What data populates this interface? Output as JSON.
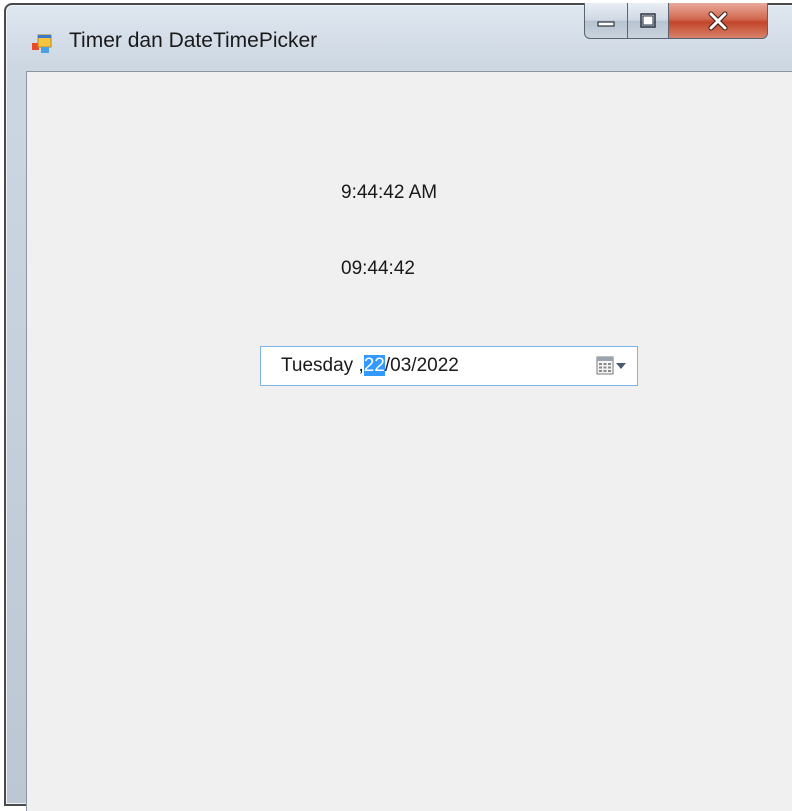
{
  "window": {
    "title": "Timer dan DateTimePicker",
    "icon": "app-window-icon",
    "controls": {
      "minimize": "minimize-icon",
      "maximize": "maximize-icon",
      "close": "close-icon"
    }
  },
  "labels": {
    "time_12h": "9:44:42 AM",
    "time_24h": "09:44:42"
  },
  "date_picker": {
    "day_name": "Tuesday",
    "sep1": " ,",
    "day": "22",
    "rest": "/03/2022",
    "selected_field": "day",
    "button_icon": "calendar-dropdown-icon"
  },
  "colors": {
    "selection": "#3399ff",
    "close_button": "#c7432a",
    "client_bg": "#f0f0f0"
  }
}
